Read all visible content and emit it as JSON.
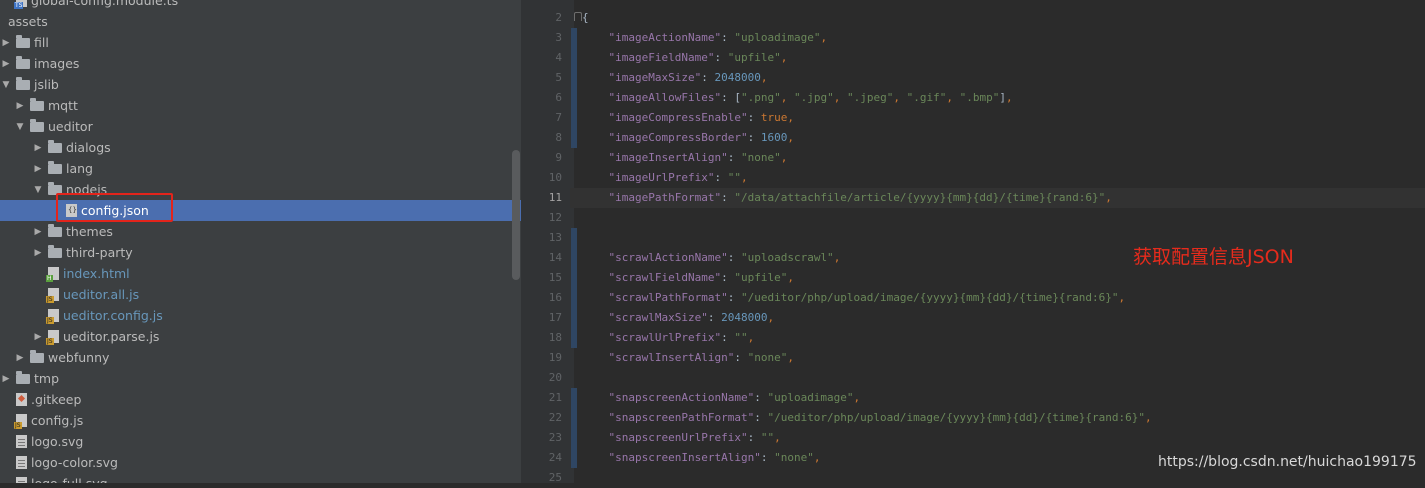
{
  "tree": {
    "items": [
      {
        "label": "global-config.module.ts",
        "kind": "file",
        "icon": "ts-file-icon",
        "color": "plain"
      },
      {
        "label": "assets",
        "kind": "none",
        "icon": "",
        "color": "plain"
      },
      {
        "label": "fill",
        "kind": "folder",
        "icon": "folder-icon",
        "color": "plain",
        "expanded": false
      },
      {
        "label": "images",
        "kind": "folder",
        "icon": "folder-icon",
        "color": "plain",
        "expanded": false
      },
      {
        "label": "jslib",
        "kind": "folder",
        "icon": "folder-icon",
        "color": "plain",
        "expanded": true
      },
      {
        "label": "mqtt",
        "kind": "folder",
        "icon": "folder-icon",
        "color": "plain",
        "expanded": false
      },
      {
        "label": "ueditor",
        "kind": "folder",
        "icon": "folder-icon",
        "color": "plain",
        "expanded": true
      },
      {
        "label": "dialogs",
        "kind": "folder",
        "icon": "folder-icon",
        "color": "plain",
        "expanded": false
      },
      {
        "label": "lang",
        "kind": "folder",
        "icon": "folder-icon",
        "color": "plain",
        "expanded": false
      },
      {
        "label": "nodejs",
        "kind": "folder",
        "icon": "folder-icon",
        "color": "plain",
        "expanded": true
      },
      {
        "label": "config.json",
        "kind": "file",
        "icon": "json-file-icon",
        "color": "plain",
        "selected": true
      },
      {
        "label": "themes",
        "kind": "folder",
        "icon": "folder-icon",
        "color": "plain",
        "expanded": false
      },
      {
        "label": "third-party",
        "kind": "folder",
        "icon": "folder-icon",
        "color": "plain",
        "expanded": false
      },
      {
        "label": "index.html",
        "kind": "file",
        "icon": "html-file-icon",
        "color": "blue"
      },
      {
        "label": "ueditor.all.js",
        "kind": "file",
        "icon": "js-file-icon",
        "color": "blue"
      },
      {
        "label": "ueditor.config.js",
        "kind": "file",
        "icon": "js-file-icon",
        "color": "blue"
      },
      {
        "label": "ueditor.parse.js",
        "kind": "file",
        "icon": "js-file-icon",
        "color": "plain",
        "expanded": false
      },
      {
        "label": "webfunny",
        "kind": "folder",
        "icon": "folder-icon",
        "color": "plain",
        "expanded": false
      },
      {
        "label": "tmp",
        "kind": "folder",
        "icon": "folder-icon",
        "color": "plain",
        "expanded": false
      },
      {
        "label": ".gitkeep",
        "kind": "file",
        "icon": "git-file-icon",
        "color": "plain"
      },
      {
        "label": "config.js",
        "kind": "file",
        "icon": "js-file-icon",
        "color": "plain"
      },
      {
        "label": "logo.svg",
        "kind": "file",
        "icon": "svg-file-icon",
        "color": "plain"
      },
      {
        "label": "logo-color.svg",
        "kind": "file",
        "icon": "svg-file-icon",
        "color": "plain"
      },
      {
        "label": "logo-full.svg",
        "kind": "file",
        "icon": "svg-file-icon",
        "color": "plain"
      }
    ]
  },
  "editor": {
    "current_line": "11",
    "lines": [
      {
        "num": "2",
        "tokens": [
          {
            "t": "{",
            "c": "p"
          }
        ]
      },
      {
        "num": "3",
        "tokens": [
          {
            "t": "    ",
            "c": "p"
          },
          {
            "t": "\"imageActionName\"",
            "c": "k"
          },
          {
            "t": ": ",
            "c": "p"
          },
          {
            "t": "\"uploadimage\"",
            "c": "s"
          },
          {
            "t": ",",
            "c": "b"
          }
        ]
      },
      {
        "num": "4",
        "tokens": [
          {
            "t": "    ",
            "c": "p"
          },
          {
            "t": "\"imageFieldName\"",
            "c": "k"
          },
          {
            "t": ": ",
            "c": "p"
          },
          {
            "t": "\"upfile\"",
            "c": "s"
          },
          {
            "t": ",",
            "c": "b"
          }
        ]
      },
      {
        "num": "5",
        "tokens": [
          {
            "t": "    ",
            "c": "p"
          },
          {
            "t": "\"imageMaxSize\"",
            "c": "k"
          },
          {
            "t": ": ",
            "c": "p"
          },
          {
            "t": "2048000",
            "c": "n"
          },
          {
            "t": ",",
            "c": "b"
          }
        ]
      },
      {
        "num": "6",
        "tokens": [
          {
            "t": "    ",
            "c": "p"
          },
          {
            "t": "\"imageAllowFiles\"",
            "c": "k"
          },
          {
            "t": ": [",
            "c": "p"
          },
          {
            "t": "\".png\"",
            "c": "s"
          },
          {
            "t": ", ",
            "c": "b"
          },
          {
            "t": "\".jpg\"",
            "c": "s"
          },
          {
            "t": ", ",
            "c": "b"
          },
          {
            "t": "\".jpeg\"",
            "c": "s"
          },
          {
            "t": ", ",
            "c": "b"
          },
          {
            "t": "\".gif\"",
            "c": "s"
          },
          {
            "t": ", ",
            "c": "b"
          },
          {
            "t": "\".bmp\"",
            "c": "s"
          },
          {
            "t": "]",
            "c": "p"
          },
          {
            "t": ",",
            "c": "b"
          }
        ]
      },
      {
        "num": "7",
        "tokens": [
          {
            "t": "    ",
            "c": "p"
          },
          {
            "t": "\"imageCompressEnable\"",
            "c": "k"
          },
          {
            "t": ": ",
            "c": "p"
          },
          {
            "t": "true",
            "c": "b"
          },
          {
            "t": ",",
            "c": "b"
          }
        ]
      },
      {
        "num": "8",
        "tokens": [
          {
            "t": "    ",
            "c": "p"
          },
          {
            "t": "\"imageCompressBorder\"",
            "c": "k"
          },
          {
            "t": ": ",
            "c": "p"
          },
          {
            "t": "1600",
            "c": "n"
          },
          {
            "t": ",",
            "c": "b"
          }
        ]
      },
      {
        "num": "9",
        "tokens": [
          {
            "t": "    ",
            "c": "p"
          },
          {
            "t": "\"imageInsertAlign\"",
            "c": "k"
          },
          {
            "t": ": ",
            "c": "p"
          },
          {
            "t": "\"none\"",
            "c": "s"
          },
          {
            "t": ",",
            "c": "b"
          }
        ]
      },
      {
        "num": "10",
        "tokens": [
          {
            "t": "    ",
            "c": "p"
          },
          {
            "t": "\"imageUrlPrefix\"",
            "c": "k"
          },
          {
            "t": ": ",
            "c": "p"
          },
          {
            "t": "\"\"",
            "c": "s"
          },
          {
            "t": ",",
            "c": "b"
          }
        ]
      },
      {
        "num": "11",
        "tokens": [
          {
            "t": "    ",
            "c": "p"
          },
          {
            "t": "\"imagePathFormat\"",
            "c": "k"
          },
          {
            "t": ": ",
            "c": "p"
          },
          {
            "t": "\"/data/attachfile/article/{yyyy}{mm}{dd}/{time}{rand:6}\"",
            "c": "s"
          },
          {
            "t": ",",
            "c": "b"
          }
        ]
      },
      {
        "num": "12",
        "tokens": []
      },
      {
        "num": "13",
        "tokens": []
      },
      {
        "num": "14",
        "tokens": [
          {
            "t": "    ",
            "c": "p"
          },
          {
            "t": "\"scrawlActionName\"",
            "c": "k"
          },
          {
            "t": ": ",
            "c": "p"
          },
          {
            "t": "\"uploadscrawl\"",
            "c": "s"
          },
          {
            "t": ",",
            "c": "b"
          }
        ]
      },
      {
        "num": "15",
        "tokens": [
          {
            "t": "    ",
            "c": "p"
          },
          {
            "t": "\"scrawlFieldName\"",
            "c": "k"
          },
          {
            "t": ": ",
            "c": "p"
          },
          {
            "t": "\"upfile\"",
            "c": "s"
          },
          {
            "t": ",",
            "c": "b"
          }
        ]
      },
      {
        "num": "16",
        "tokens": [
          {
            "t": "    ",
            "c": "p"
          },
          {
            "t": "\"scrawlPathFormat\"",
            "c": "k"
          },
          {
            "t": ": ",
            "c": "p"
          },
          {
            "t": "\"/ueditor/php/upload/image/{yyyy}{mm}{dd}/{time}{rand:6}\"",
            "c": "s"
          },
          {
            "t": ",",
            "c": "b"
          }
        ]
      },
      {
        "num": "17",
        "tokens": [
          {
            "t": "    ",
            "c": "p"
          },
          {
            "t": "\"scrawlMaxSize\"",
            "c": "k"
          },
          {
            "t": ": ",
            "c": "p"
          },
          {
            "t": "2048000",
            "c": "n"
          },
          {
            "t": ",",
            "c": "b"
          }
        ]
      },
      {
        "num": "18",
        "tokens": [
          {
            "t": "    ",
            "c": "p"
          },
          {
            "t": "\"scrawlUrlPrefix\"",
            "c": "k"
          },
          {
            "t": ": ",
            "c": "p"
          },
          {
            "t": "\"\"",
            "c": "s"
          },
          {
            "t": ",",
            "c": "b"
          }
        ]
      },
      {
        "num": "19",
        "tokens": [
          {
            "t": "    ",
            "c": "p"
          },
          {
            "t": "\"scrawlInsertAlign\"",
            "c": "k"
          },
          {
            "t": ": ",
            "c": "p"
          },
          {
            "t": "\"none\"",
            "c": "s"
          },
          {
            "t": ",",
            "c": "b"
          }
        ]
      },
      {
        "num": "20",
        "tokens": []
      },
      {
        "num": "21",
        "tokens": [
          {
            "t": "    ",
            "c": "p"
          },
          {
            "t": "\"snapscreenActionName\"",
            "c": "k"
          },
          {
            "t": ": ",
            "c": "p"
          },
          {
            "t": "\"uploadimage\"",
            "c": "s"
          },
          {
            "t": ",",
            "c": "b"
          }
        ]
      },
      {
        "num": "22",
        "tokens": [
          {
            "t": "    ",
            "c": "p"
          },
          {
            "t": "\"snapscreenPathFormat\"",
            "c": "k"
          },
          {
            "t": ": ",
            "c": "p"
          },
          {
            "t": "\"/ueditor/php/upload/image/{yyyy}{mm}{dd}/{time}{rand:6}\"",
            "c": "s"
          },
          {
            "t": ",",
            "c": "b"
          }
        ]
      },
      {
        "num": "23",
        "tokens": [
          {
            "t": "    ",
            "c": "p"
          },
          {
            "t": "\"snapscreenUrlPrefix\"",
            "c": "k"
          },
          {
            "t": ": ",
            "c": "p"
          },
          {
            "t": "\"\"",
            "c": "s"
          },
          {
            "t": ",",
            "c": "b"
          }
        ]
      },
      {
        "num": "24",
        "tokens": [
          {
            "t": "    ",
            "c": "p"
          },
          {
            "t": "\"snapscreenInsertAlign\"",
            "c": "k"
          },
          {
            "t": ": ",
            "c": "p"
          },
          {
            "t": "\"none\"",
            "c": "s"
          },
          {
            "t": ",",
            "c": "b"
          }
        ]
      },
      {
        "num": "25",
        "tokens": []
      }
    ]
  },
  "annotation": "获取配置信息JSON",
  "watermark": "https://blog.csdn.net/huichao199175",
  "colors": {
    "tree_bg": "#3c3f41",
    "editor_bg": "#2b2b2b",
    "selection": "#4b6eaf",
    "highlight_box": "#e3241b",
    "annotation": "#e62b1c"
  }
}
